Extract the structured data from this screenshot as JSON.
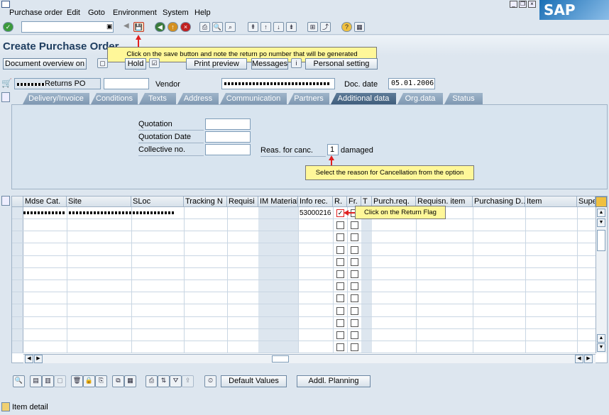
{
  "menu": [
    "Purchase order",
    "Edit",
    "Goto",
    "Environment",
    "System",
    "Help"
  ],
  "sap_logo": "SAP",
  "page_title": "Create Purchase Order",
  "app_toolbar": {
    "document_overview": "Document overview on",
    "hold": "Hold",
    "print_preview": "Print preview",
    "messages": "Messages",
    "personal_setting": "Personal setting"
  },
  "callouts": {
    "save": "Click on the save button and note the return po number that will be generated",
    "reason": "Select  the reason for  Cancellation from the option",
    "return_flag": "Click on the Return Flag"
  },
  "header": {
    "doc_type": "Returns PO",
    "vendor_label": "Vendor",
    "doc_date_label": "Doc. date",
    "doc_date": "05.01.2006"
  },
  "tabs": [
    "Delivery/Invoice",
    "Conditions",
    "Texts",
    "Address",
    "Communication",
    "Partners",
    "Additional data",
    "Org.data",
    "Status"
  ],
  "active_tab": "Additional data",
  "additional_data": {
    "quotation_label": "Quotation",
    "quotation_date_label": "Quotation Date",
    "collective_no_label": "Collective no.",
    "reas_label": "Reas. for canc.",
    "reas_value": "1",
    "reas_text": "damaged"
  },
  "grid": {
    "columns": [
      "Mdse Cat.",
      "Site",
      "SLoc",
      "Tracking N",
      "Requisi",
      "IM Material",
      "Info rec.",
      "R.",
      "Fr.",
      "T",
      "Purch.req.",
      "Requisn. item",
      "Purchasing D...",
      "Item",
      "Supe"
    ],
    "first_row_info_rec": "53000216",
    "return_flag_checked": true,
    "row_count": 12
  },
  "bottom_buttons": {
    "default_values": "Default Values",
    "addl_planning": "Addl. Planning"
  },
  "status": {
    "item_detail": "Item detail"
  },
  "colors": {
    "accent": "#1f3e60",
    "callout": "#fff799",
    "arrow": "#e02020"
  }
}
